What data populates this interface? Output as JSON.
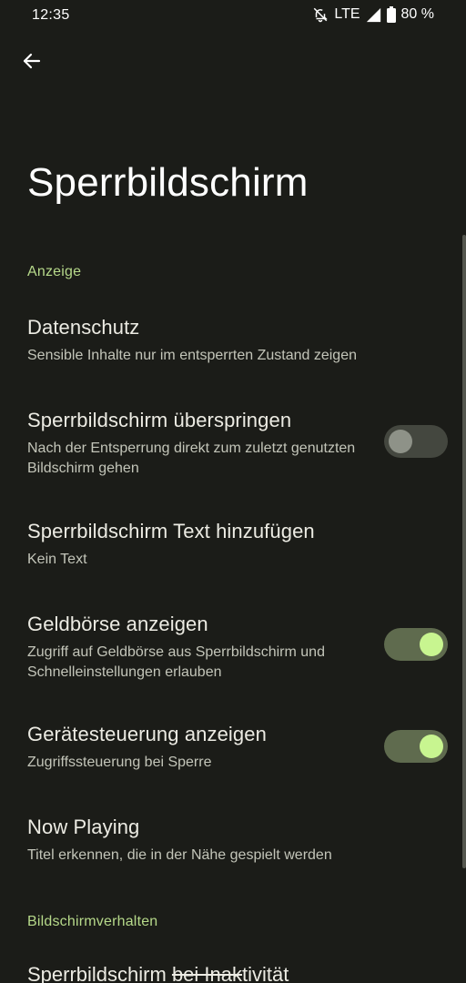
{
  "status": {
    "time": "12:35",
    "network": "LTE",
    "battery": "80 %",
    "icons": [
      "bell-off-icon",
      "signal-icon",
      "battery-icon"
    ]
  },
  "header": {
    "back_icon": "arrow-left-icon",
    "title": "Sperrbildschirm"
  },
  "sections": {
    "display_header": "Anzeige",
    "behavior_header": "Bildschirmverhalten"
  },
  "items": [
    {
      "title": "Datenschutz",
      "summary": "Sensible Inhalte nur im entsperrten Zustand zeigen"
    },
    {
      "title": "Sperrbildschirm überspringen",
      "summary": "Nach der Entsperrung direkt zum zuletzt genutzten Bildschirm gehen",
      "toggle": false
    },
    {
      "title": "Sperrbildschirm Text hinzufügen",
      "summary": "Kein Text"
    },
    {
      "title": "Geldbörse anzeigen",
      "summary": "Zugriff auf Geldbörse aus Sperrbildschirm und Schnelleinstellungen erlauben",
      "toggle": true
    },
    {
      "title": "Gerätesteuerung anzeigen",
      "summary": "Zugriffssteuerung bei Sperre",
      "toggle": true
    },
    {
      "title": "Now Playing",
      "summary": "Titel erkennen, die in der Nähe gespielt werden"
    }
  ],
  "partial_item": {
    "title_a": "Sperrbildschirm ",
    "title_b": "bei Inak",
    "title_c": "tivität"
  },
  "colors": {
    "background": "#1b1c18",
    "accent": "#b6d98a",
    "toggle_on_track": "#5f6b4e",
    "toggle_on_thumb": "#c8f590",
    "toggle_off_track": "#44473f"
  }
}
